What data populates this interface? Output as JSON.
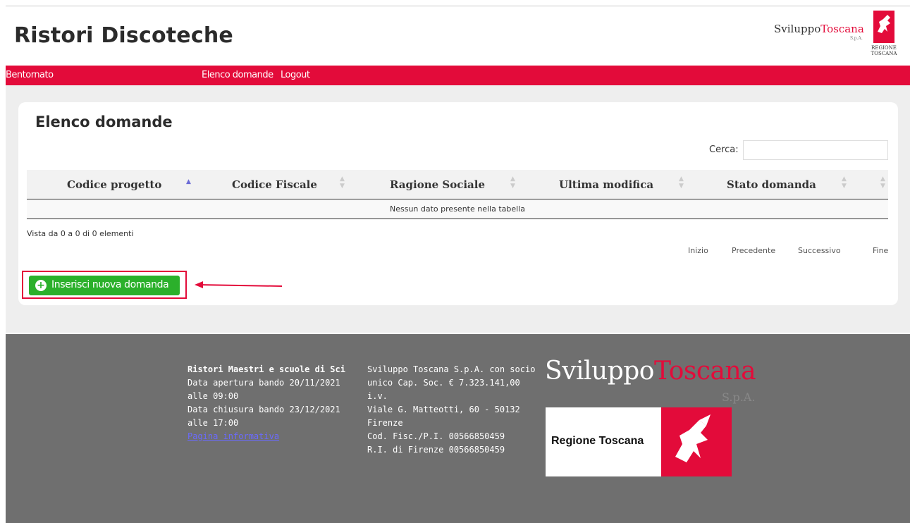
{
  "header": {
    "title": "Ristori Discoteche",
    "brand_sviluppo": "Sviluppo",
    "brand_toscana": "Toscana",
    "brand_spa": "S.p.A.",
    "region_line1": "REGIONE",
    "region_line2": "TOSCANA"
  },
  "nav": {
    "welcome": "Bentornato",
    "list": "Elenco domande",
    "logout": "Logout"
  },
  "panel": {
    "title": "Elenco domande",
    "search_label": "Cerca:",
    "search_value": "",
    "columns": [
      "Codice progetto",
      "Codice Fiscale",
      "Ragione Sociale",
      "Ultima modifica",
      "Stato domanda"
    ],
    "empty_message": "Nessun dato presente nella tabella",
    "info": "Vista da 0 a 0 di 0 elementi",
    "pager": {
      "first": "Inizio",
      "prev": "Precedente",
      "next": "Successivo",
      "last": "Fine"
    },
    "add_button": "Inserisci nuova domanda"
  },
  "footer": {
    "col1_title": "Ristori Maestri e scuole di Sci",
    "col1_open": "Data apertura bando 20/11/2021 alle 09:00",
    "col1_close": "Data chiusura bando 23/12/2021 alle 17:00",
    "col1_link": "Pagina informativa",
    "col2_line1": "Sviluppo Toscana S.p.A. con socio unico Cap. Soc. € 7.323.141,00 i.v.",
    "col2_line2": "Viale G. Matteotti, 60 - 50132 Firenze",
    "col2_line3": "Cod. Fisc./P.I. 00566850459",
    "col2_line4": "R.I. di Firenze 00566850459",
    "brand_sviluppo": "Sviluppo",
    "brand_toscana": "Toscana",
    "brand_spa": "S.p.A.",
    "region_label": "Regione Toscana"
  },
  "colors": {
    "accent_red": "#e30b3a",
    "button_green": "#2bb02b",
    "footer_gray": "#6f6f6f"
  }
}
